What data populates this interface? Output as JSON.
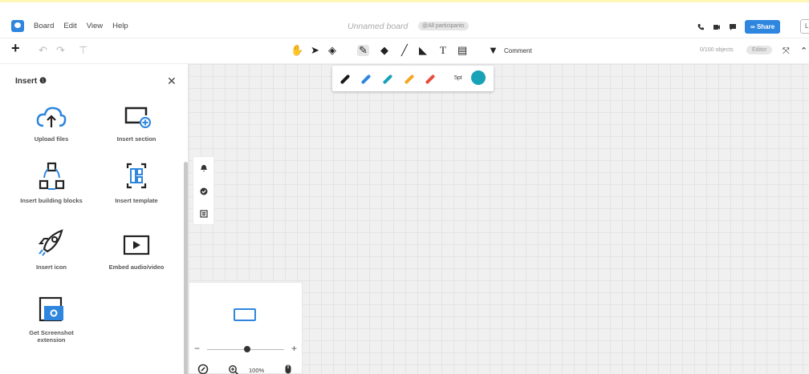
{
  "menubar": {
    "items": [
      "Board",
      "Edit",
      "View",
      "Help"
    ],
    "board_title": "Unnamed board",
    "participants": "@All participants",
    "share_label": "Share",
    "avatar_letter": "L"
  },
  "toolbar": {
    "comment_label": "Comment",
    "objects_count": "0/100 objects",
    "editor_label": "Editor",
    "icons": [
      "hand-icon",
      "pointer-icon",
      "eraser-icon",
      "pen-icon",
      "marker-icon",
      "line-icon",
      "shapes-icon",
      "text-icon",
      "note-icon",
      "comment-icon"
    ]
  },
  "pen_panel": {
    "size_label": "5pt",
    "pen_colors": [
      "#1a1a1a",
      "#2e86de",
      "#17a2b8",
      "#f5a623",
      "#e74c3c"
    ],
    "selected_color": "#17a2b8"
  },
  "insert": {
    "title": "Insert",
    "items": [
      {
        "label": "Upload files",
        "icon": "cloud-upload-icon"
      },
      {
        "label": "Insert section",
        "icon": "section-icon"
      },
      {
        "label": "Insert building blocks",
        "icon": "building-blocks-icon"
      },
      {
        "label": "Insert template",
        "icon": "template-icon"
      },
      {
        "label": "Insert icon",
        "icon": "rocket-icon"
      },
      {
        "label": "Embed audio/video",
        "icon": "play-icon"
      },
      {
        "label": "Get Screenshot extension",
        "icon": "screenshot-icon"
      }
    ]
  },
  "navigator": {
    "zoom_percent": "100%"
  },
  "colors": {
    "accent": "#2e86de",
    "canvas": "#f0f0f0",
    "grid": "#e4e4e4",
    "banner": "#fff7b8"
  }
}
